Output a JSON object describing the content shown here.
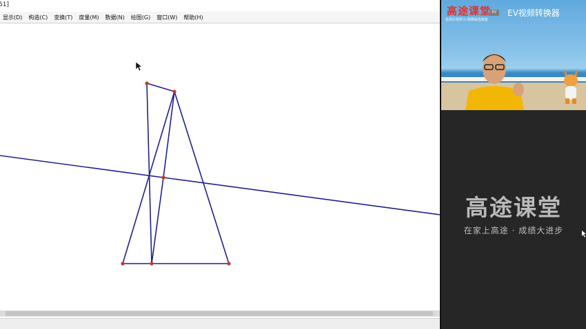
{
  "window": {
    "title": "51]"
  },
  "menu": [
    {
      "label": "显示(D)"
    },
    {
      "label": "构造(C)"
    },
    {
      "label": "变换(T)"
    },
    {
      "label": "度量(M)"
    },
    {
      "label": "数据(N)"
    },
    {
      "label": "绘图(G)"
    },
    {
      "label": "窗口(W)"
    },
    {
      "label": "帮助(H)"
    }
  ],
  "colors": {
    "segment": "#1f1f8f",
    "point": "#c0392b",
    "brand_red": "#e3312a",
    "panel_bg": "#262626",
    "panel_text": "#b9b9b9"
  },
  "video": {
    "brand": "高途课堂",
    "brand_sub": "名师引领学习   网课就选高途",
    "badge": "EV",
    "converter": "EV视频转换器"
  },
  "panel": {
    "brand": "高途课堂",
    "slogan": "在家上高途 · 成绩大进步"
  }
}
